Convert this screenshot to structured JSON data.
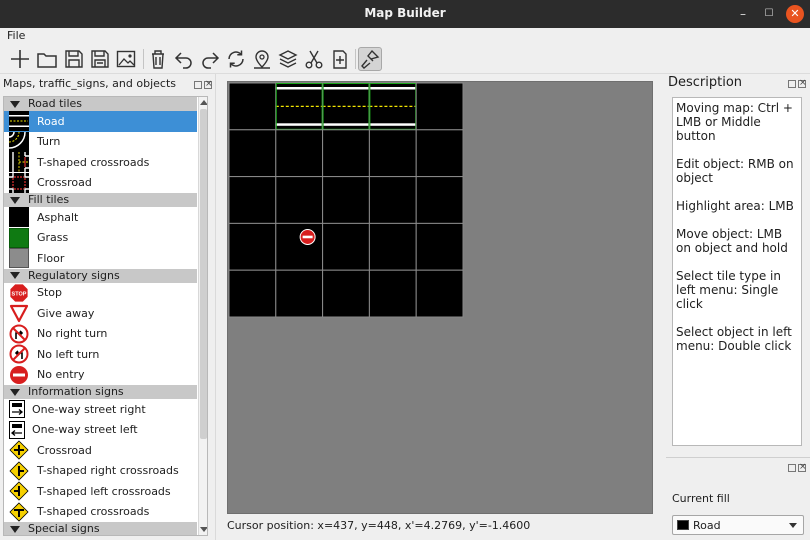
{
  "window": {
    "title": "Map Builder",
    "minimize_glyph": "–",
    "maximize_glyph": "☐",
    "close_glyph": "✕"
  },
  "menu": {
    "file": "File"
  },
  "toolbar": [
    {
      "name": "new-icon"
    },
    {
      "name": "open-folder-icon"
    },
    {
      "name": "save-icon"
    },
    {
      "name": "save-as-icon"
    },
    {
      "name": "image-icon"
    },
    {
      "name": "delete-icon"
    },
    {
      "name": "undo-icon"
    },
    {
      "name": "redo-icon"
    },
    {
      "name": "rotate-icon"
    },
    {
      "name": "location-pin-icon"
    },
    {
      "name": "layers-icon"
    },
    {
      "name": "cut-icon"
    },
    {
      "name": "insert-icon"
    },
    {
      "name": "brush-icon"
    }
  ],
  "left_panel": {
    "title": "Maps, traffic_signs, and objects",
    "categories": [
      {
        "label": "Road tiles",
        "items": [
          {
            "label": "Road",
            "icon": "road-tile-icon",
            "selected": true
          },
          {
            "label": "Turn",
            "icon": "turn-tile-icon"
          },
          {
            "label": "T-shaped crossroads",
            "icon": "t-crossroads-tile-icon"
          },
          {
            "label": "Crossroad",
            "icon": "crossroad-tile-icon"
          }
        ]
      },
      {
        "label": "Fill tiles",
        "items": [
          {
            "label": "Asphalt",
            "icon": "asphalt-tile-icon"
          },
          {
            "label": "Grass",
            "icon": "grass-tile-icon"
          },
          {
            "label": "Floor",
            "icon": "floor-tile-icon"
          }
        ]
      },
      {
        "label": "Regulatory signs",
        "items": [
          {
            "label": "Stop",
            "icon": "stop-sign-icon"
          },
          {
            "label": "Give away",
            "icon": "give-way-sign-icon"
          },
          {
            "label": "No right turn",
            "icon": "no-right-turn-sign-icon"
          },
          {
            "label": "No left turn",
            "icon": "no-left-turn-sign-icon"
          },
          {
            "label": "No entry",
            "icon": "no-entry-sign-icon"
          }
        ]
      },
      {
        "label": "Information signs",
        "items": [
          {
            "label": "One-way street right",
            "icon": "one-way-right-sign-icon"
          },
          {
            "label": "One-way street left",
            "icon": "one-way-left-sign-icon"
          },
          {
            "label": "Crossroad",
            "icon": "crossroad-sign-icon"
          },
          {
            "label": "T-shaped right crossroads",
            "icon": "t-right-sign-icon"
          },
          {
            "label": "T-shaped left crossroads",
            "icon": "t-left-sign-icon"
          },
          {
            "label": "T-shaped crossroads",
            "icon": "t-sign-icon"
          }
        ]
      },
      {
        "label": "Special signs",
        "items": []
      }
    ]
  },
  "map": {
    "cols": 5,
    "rows": 5,
    "road_tiles": [
      [
        0,
        1
      ],
      [
        0,
        2
      ],
      [
        0,
        3
      ]
    ],
    "objects": [
      {
        "type": "no-entry-sign-icon",
        "row": 3,
        "col": 1
      }
    ]
  },
  "status": {
    "cursor": "Cursor position: x=437, y=448, x'=4.2769, y'=-1.4600"
  },
  "right_panel": {
    "title": "Description",
    "description": "Moving map: Ctrl + LMB or Middle button\n\nEdit object: RMB on object\n\nHighlight area: LMB\n\nMove object: LMB on object and hold\n\nSelect tile type in left menu: Single click\n\nSelect object in left menu: Double click",
    "fill_label": "Current fill",
    "fill_value": "Road"
  },
  "colors": {
    "selection": "#3d8fd6",
    "map_bg": "#7f7f7f",
    "grid_line": "#8a8a8a",
    "road_line": "#f2e400",
    "close_button": "#e95420"
  }
}
